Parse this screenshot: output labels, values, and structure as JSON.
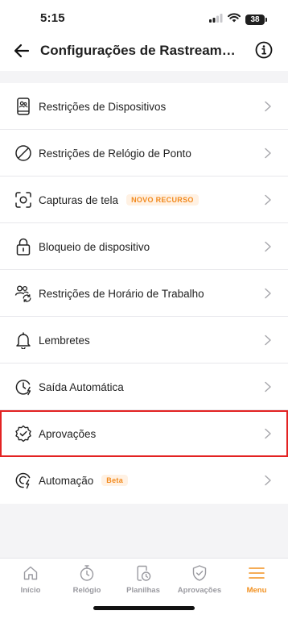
{
  "status_bar": {
    "time": "5:15",
    "battery": "38",
    "icons": [
      "signal-icon",
      "wifi-icon",
      "battery-icon"
    ]
  },
  "header": {
    "title": "Configurações de Rastreament...",
    "back_icon": "back-arrow-icon",
    "info_icon": "info-icon"
  },
  "settings": {
    "items": [
      {
        "label": "Restrições de Dispositivos",
        "icon": "device-user-icon"
      },
      {
        "label": "Restrições de Relógio de Ponto",
        "icon": "prohibited-icon"
      },
      {
        "label": "Capturas de tela",
        "icon": "screenshot-icon",
        "badge": "NOVO RECURSO"
      },
      {
        "label": "Bloqueio de dispositivo",
        "icon": "lock-icon"
      },
      {
        "label": "Restrições de Horário de Trabalho",
        "icon": "users-sync-icon"
      },
      {
        "label": "Lembretes",
        "icon": "bell-icon"
      },
      {
        "label": "Saída Automática",
        "icon": "auto-clock-out-icon"
      },
      {
        "label": "Aprovações",
        "icon": "approval-badge-icon",
        "highlighted": true
      },
      {
        "label": "Automação",
        "icon": "automation-icon",
        "badge": "Beta"
      }
    ]
  },
  "bottom_nav": {
    "items": [
      {
        "label": "Início",
        "icon": "home-icon",
        "active": false
      },
      {
        "label": "Relógio",
        "icon": "stopwatch-icon",
        "active": false
      },
      {
        "label": "Planilhas",
        "icon": "timesheet-icon",
        "active": false
      },
      {
        "label": "Aprovações",
        "icon": "shield-check-icon",
        "active": false
      },
      {
        "label": "Menu",
        "icon": "menu-icon",
        "active": true
      }
    ]
  },
  "colors": {
    "accent": "#f2901f",
    "badge_bg": "#fff1e3",
    "highlight": "#e32222",
    "background": "#f4f4f6"
  }
}
